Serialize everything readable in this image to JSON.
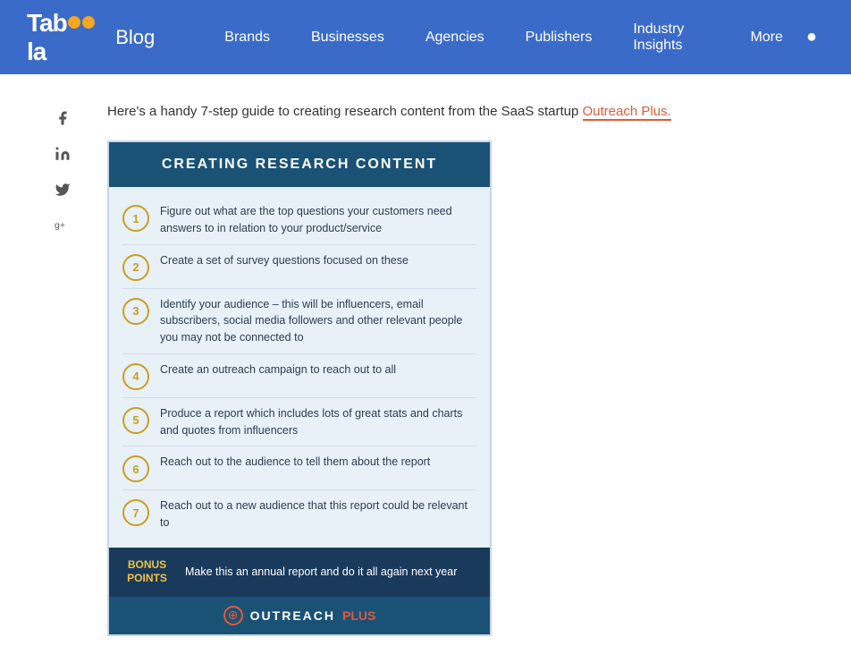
{
  "header": {
    "logo_main": "Tab",
    "logo_oo": "oo",
    "logo_la": "la",
    "logo_blog": "Blog",
    "nav": [
      {
        "label": "Brands",
        "id": "brands"
      },
      {
        "label": "Businesses",
        "id": "businesses"
      },
      {
        "label": "Agencies",
        "id": "agencies"
      },
      {
        "label": "Publishers",
        "id": "publishers"
      },
      {
        "label": "Industry Insights",
        "id": "industry-insights"
      },
      {
        "label": "More",
        "id": "more"
      }
    ]
  },
  "article": {
    "intro": "Here's a handy 7-step guide to creating research content from the SaaS startup ",
    "link_text": "Outreach Plus.",
    "infographic_title": "CREATING RESEARCH CONTENT",
    "steps": [
      {
        "num": "1",
        "text": "Figure out what are the top questions your customers need answers to in relation to your product/service"
      },
      {
        "num": "2",
        "text": "Create a set of survey questions focused on these"
      },
      {
        "num": "3",
        "text": "Identify your audience – this will be influencers, email subscribers, social media followers and other relevant people you may not be connected to"
      },
      {
        "num": "4",
        "text": "Create an outreach campaign to reach out to all"
      },
      {
        "num": "5",
        "text": "Produce a report which includes lots of great stats and charts and quotes from influencers"
      },
      {
        "num": "6",
        "text": "Reach out to the audience to tell them about the report"
      },
      {
        "num": "7",
        "text": "Reach out to a new audience that this report could be relevant to"
      }
    ],
    "bonus_label": "BONUS\nPOINTS",
    "bonus_text": "Make this an annual report and do it all again next year",
    "brand_name": "OUTREACH",
    "brand_plus": "PLUS"
  },
  "social": {
    "facebook": "f",
    "linkedin": "in",
    "twitter": "t",
    "googleplus": "g+"
  }
}
